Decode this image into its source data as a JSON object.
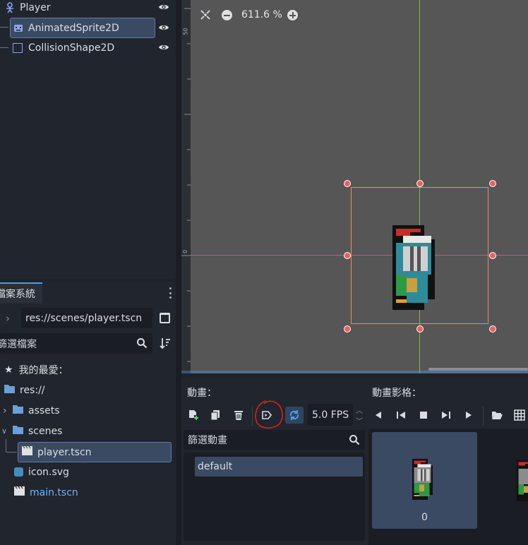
{
  "scene_tree": {
    "items": [
      {
        "label": "Player"
      },
      {
        "label": "AnimatedSprite2D"
      },
      {
        "label": "CollisionShape2D"
      }
    ]
  },
  "viewport": {
    "zoom_label": "611.6 %",
    "ruler_top": "50",
    "ruler_zero": "0"
  },
  "filesystem": {
    "tab_label": "檔案系統",
    "path_value": "res://scenes/player.tscn",
    "filter_placeholder": "篩選檔案",
    "favorites_label": "我的最愛：",
    "tree": [
      {
        "label": "res://"
      },
      {
        "label": "assets"
      },
      {
        "label": "scenes"
      },
      {
        "label": "player.tscn"
      },
      {
        "label": "icon.svg"
      },
      {
        "label": "main.tscn"
      }
    ]
  },
  "sprite_frames": {
    "animations_label": "動畫：",
    "frames_label": "動畫影格：",
    "fps_value": "5.0 FPS",
    "filter_animations_placeholder": "篩選動畫",
    "animations": [
      {
        "label": "default"
      }
    ],
    "frames": [
      {
        "index": "0"
      }
    ]
  },
  "colors": {
    "accent": "#4a9ee8",
    "selection": "#3a4a63",
    "viewport_bg": "#565656",
    "highlight_link": "#6fb4f5",
    "annotation_red": "#e01e1e"
  }
}
